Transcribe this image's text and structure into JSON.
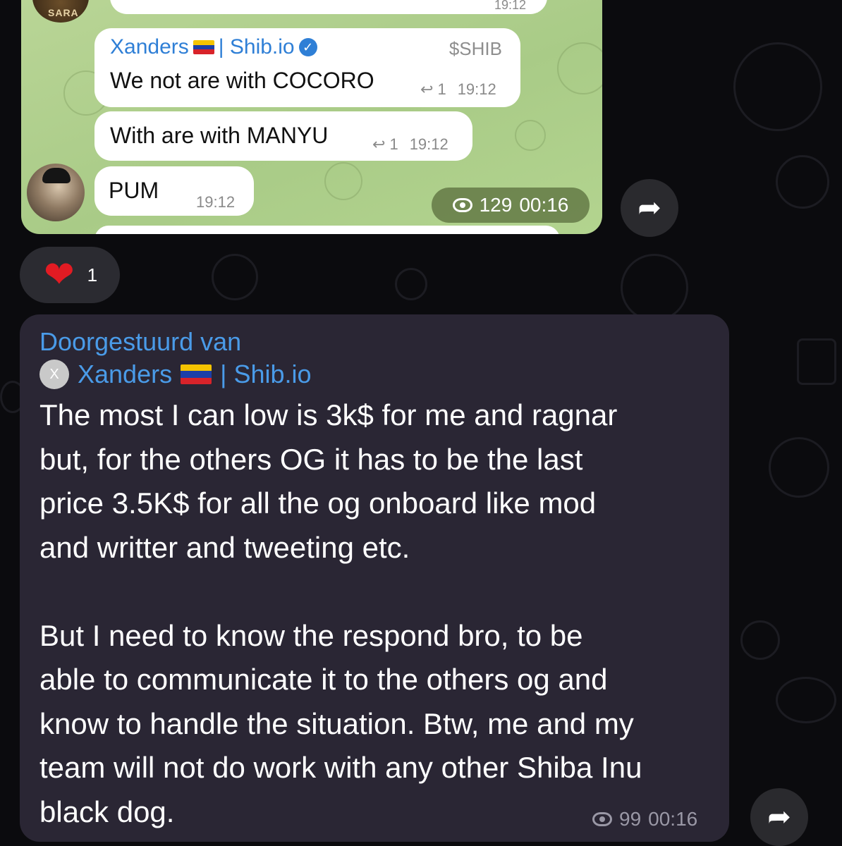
{
  "top_screenshot": {
    "previous": {
      "avatar_label": "SARA",
      "time": "19:12"
    },
    "message1": {
      "sender": "Xanders",
      "sender_suffix": "| Shib.io",
      "tag": "$SHIB",
      "text": "We not are with COCORO",
      "reply_count": "1",
      "time": "19:12"
    },
    "message2": {
      "text": "With are with MANYU",
      "reply_count": "1",
      "time": "19:12"
    },
    "message3": {
      "text": "PUM",
      "time": "19:12"
    },
    "views": "129",
    "views_time": "00:16"
  },
  "reaction": {
    "emoji": "❤",
    "count": "1"
  },
  "forwarded": {
    "label": "Doorgestuurd van",
    "avatar_letter": "X",
    "sender": "Xanders",
    "sender_suffix": "| Shib.io",
    "body": "The most I can low is 3k$ for me and ragnar\nbut, for the others OG it has to be the last\nprice 3.5K$ for all the og onboard like mod\nand writter and tweeting etc.\n\nBut I need to know the respond bro, to be\nable to communicate it to the others og and\nknow to handle the situation. Btw, me and my\nteam will not do work with any other Shiba Inu\nblack dog.",
    "views": "99",
    "time": "00:16"
  },
  "colors": {
    "accent_link": "#4a9be8",
    "bubble_dark": "#2a2634",
    "chat_green": "#b9d596",
    "heart": "#e21b23"
  }
}
